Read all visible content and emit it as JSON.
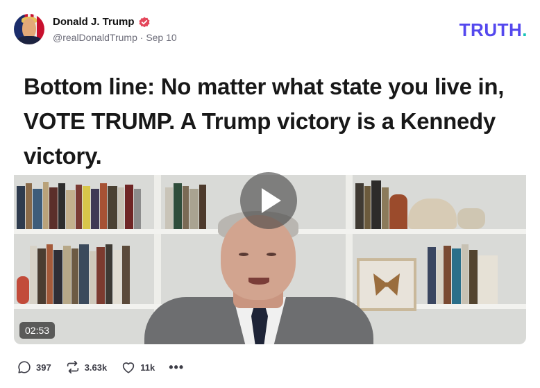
{
  "post": {
    "author": {
      "display_name": "Donald J. Trump",
      "handle": "@realDonaldTrump",
      "separator": "·",
      "date": "Sep 10",
      "verified_badge": "verified-icon",
      "avatar": "avatar"
    },
    "brand": {
      "logo_text": "TRUTH",
      "logo_dot": ".",
      "colors": {
        "primary": "#5448ee",
        "accent": "#18c4b8"
      }
    },
    "video": {
      "caption": "Bottom line: No matter what state you live in, VOTE TRUMP. A Trump victory is a Kennedy victory.",
      "duration": "02:53",
      "play_icon": "play-icon"
    },
    "actions": {
      "reply_count": "397",
      "retruth_count": "3.63k",
      "like_count": "11k",
      "more_label": "•••"
    }
  }
}
